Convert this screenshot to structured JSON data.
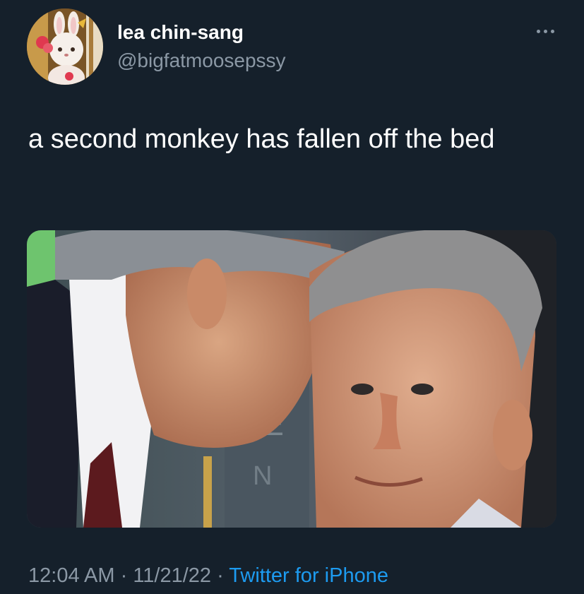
{
  "user": {
    "display_name": "lea chin-sang",
    "handle": "@bigfatmoosepssy",
    "avatar_icon": "bunny-plush-avatar"
  },
  "tweet": {
    "text": "a second monkey has fallen off the bed",
    "image_icon": "photo-two-men-whispering"
  },
  "meta": {
    "time": "12:04 AM",
    "sep1": " · ",
    "date": "11/21/22",
    "sep2": " · ",
    "source": "Twitter for iPhone"
  },
  "menu": {
    "icon": "more-options-icon"
  },
  "colors": {
    "background": "#15202b",
    "secondary_text": "#8b98a5",
    "link": "#1d9bf0"
  }
}
